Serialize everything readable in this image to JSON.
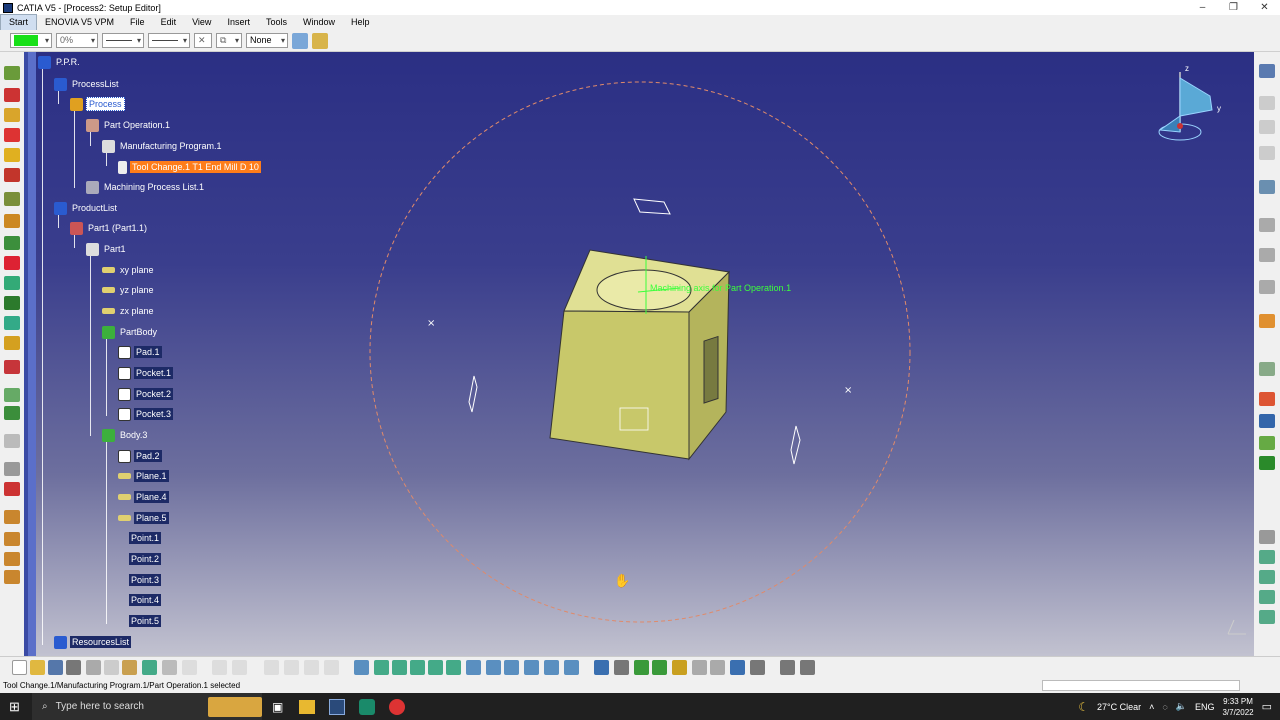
{
  "window": {
    "title": "CATIA V5 - [Process2: Setup Editor]",
    "controls": [
      "–",
      "❐",
      "✕"
    ]
  },
  "menu": [
    "Start",
    "ENOVIA V5 VPM",
    "File",
    "Edit",
    "View",
    "Insert",
    "Tools",
    "Window",
    "Help"
  ],
  "toolbar": {
    "color": "#18e018",
    "transparency": "0%",
    "layer": "None"
  },
  "tree": {
    "ppr": "P.P.R.",
    "process_list": "ProcessList",
    "process": "Process",
    "part_operation": "Part Operation.1",
    "manufacturing_program": "Manufacturing Program.1",
    "tool_change": "Tool Change.1  T1 End Mill D 10",
    "machining_process_list": "Machining Process List.1",
    "product_list": "ProductList",
    "part1_instance": "Part1 (Part1.1)",
    "part1": "Part1",
    "xy_plane": "xy plane",
    "yz_plane": "yz plane",
    "zx_plane": "zx plane",
    "part_body": "PartBody",
    "pad1": "Pad.1",
    "pocket1": "Pocket.1",
    "pocket2": "Pocket.2",
    "pocket3": "Pocket.3",
    "body3": "Body.3",
    "pad2": "Pad.2",
    "plane1": "Plane.1",
    "plane4": "Plane.4",
    "plane5": "Plane.5",
    "point1": "Point.1",
    "point2": "Point.2",
    "point3": "Point.3",
    "point4": "Point.4",
    "point5": "Point.5",
    "resources_list": "ResourcesList"
  },
  "viewport": {
    "axis_label": "Machining axis for Part Operation.1",
    "compass_labels": [
      "z",
      "y"
    ]
  },
  "status": {
    "message": "Tool Change.1/Manufacturing Program.1/Part Operation.1 selected"
  },
  "taskbar": {
    "search_placeholder": "Type here to search",
    "weather": "27°C  Clear",
    "language": "ENG",
    "time": "9:33 PM",
    "date": "3/7/2022"
  }
}
